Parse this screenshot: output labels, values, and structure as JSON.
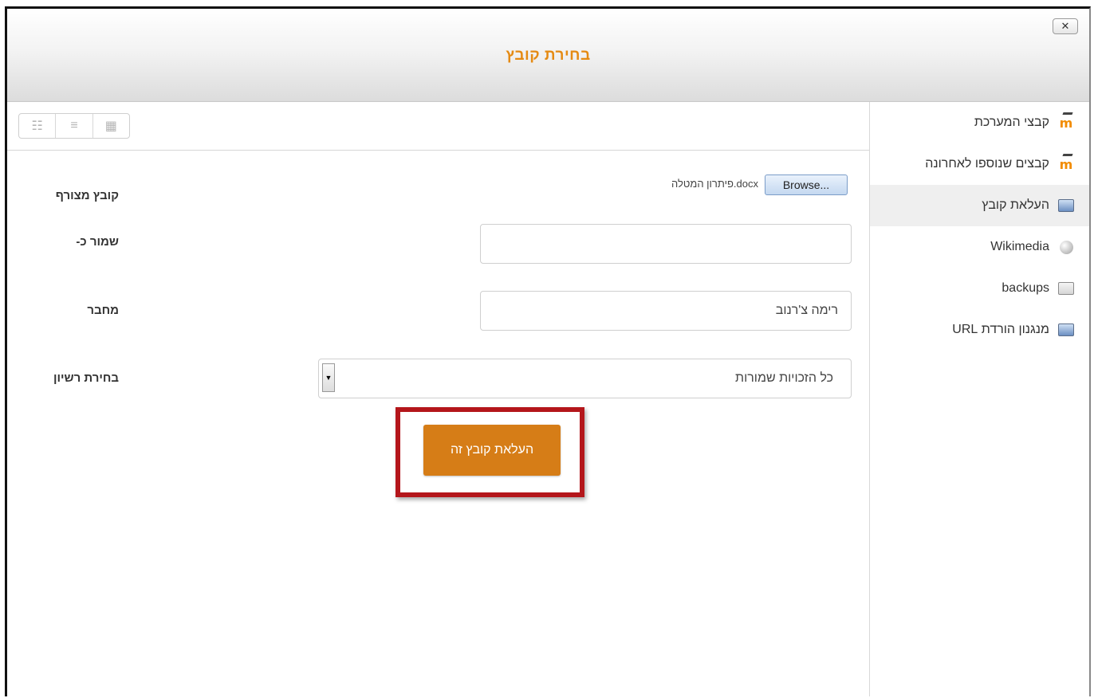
{
  "dialog": {
    "title": "בחירת קובץ",
    "close_icon": "close-icon",
    "close_glyph": "✕"
  },
  "sidebar": {
    "items": [
      {
        "label": "קבצי המערכת",
        "icon": "moodle-icon",
        "active": false
      },
      {
        "label": "קבצים שנוספו לאחרונה",
        "icon": "moodle-icon",
        "active": false
      },
      {
        "label": "העלאת קובץ",
        "icon": "upload-icon",
        "active": true
      },
      {
        "label": "Wikimedia",
        "icon": "wikimedia-icon",
        "active": false
      },
      {
        "label": "backups",
        "icon": "backup-icon",
        "active": false
      },
      {
        "label": "מנגנון הורדת URL",
        "icon": "url-download-icon",
        "active": false
      }
    ]
  },
  "toolbar": {
    "view_buttons": [
      "icons-view-icon",
      "list-view-icon",
      "tree-view-icon"
    ]
  },
  "form": {
    "attachment_label": "קובץ מצורף",
    "browse_label": "Browse...",
    "selected_file": "פיתרון המטלה.docx",
    "save_as_label": "שמור כ-",
    "save_as_value": "",
    "author_label": "מחבר",
    "author_value": "רימה צ'רנוב",
    "license_label": "בחירת רשיון",
    "license_value": "כל הזכויות שמורות",
    "upload_button": "העלאת קובץ זה"
  },
  "colors": {
    "title": "#e58a12",
    "upload_button": "#d67d17",
    "highlight_border": "#b4161b"
  }
}
